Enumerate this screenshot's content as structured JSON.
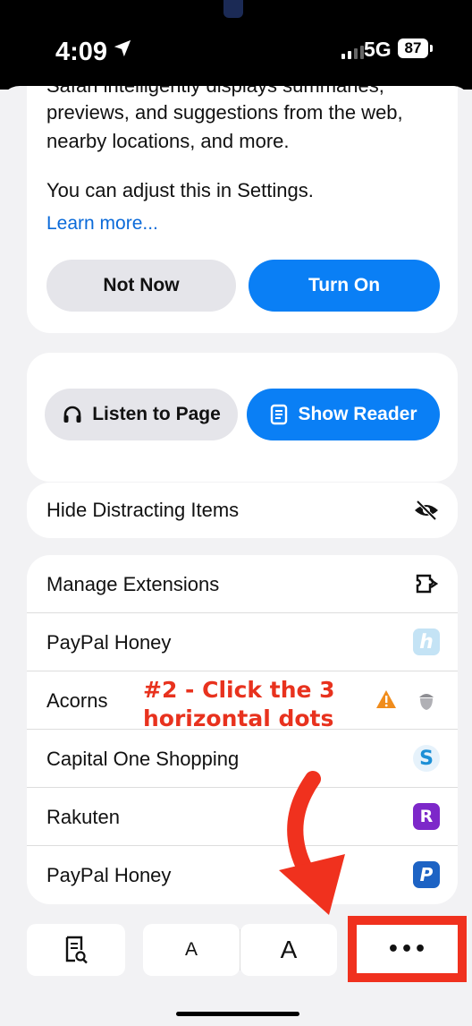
{
  "status": {
    "time": "4:09",
    "network": "5G",
    "battery": "87"
  },
  "intelligence": {
    "cut_text": "Safari intelligently displays summaries,",
    "description": "previews, and suggestions from the web, nearby locations, and more.",
    "adjust": "You can adjust this in Settings.",
    "learn_more": "Learn more...",
    "not_now": "Not Now",
    "turn_on": "Turn On"
  },
  "actions": {
    "listen": "Listen to Page",
    "reader": "Show Reader"
  },
  "hide_distracting": "Hide Distracting Items",
  "extensions": [
    {
      "label": "Manage Extensions",
      "icon": "extensions-icon"
    },
    {
      "label": "PayPal Honey",
      "icon": "honey-icon",
      "color": "#7ec3ea"
    },
    {
      "label": "Acorns",
      "icon": "acorn-icon",
      "warning_color": "#f08c1c"
    },
    {
      "label": "Capital One Shopping",
      "icon": "capital-one-s-icon",
      "color": "#1c8fd6"
    },
    {
      "label": "Rakuten",
      "icon": "rakuten-icon",
      "color": "#7d28c9"
    },
    {
      "label": "PayPal Honey",
      "icon": "paypal-icon",
      "color": "#1d63c4"
    }
  ],
  "annotation": {
    "line1": "#2 - Click the 3",
    "line2": "horizontal dots",
    "color": "#e8321e"
  },
  "toolbar": {
    "font_small": "A",
    "font_large": "A",
    "more": "•••"
  },
  "colors": {
    "accent": "#0a7ff5",
    "highlight_box": "#f0311e"
  }
}
